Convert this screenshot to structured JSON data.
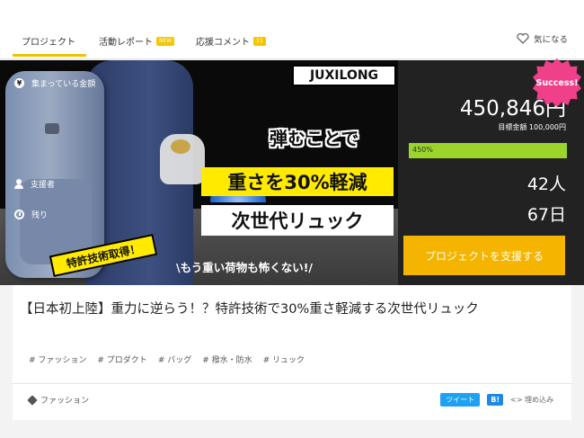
{
  "tabs": [
    {
      "label": "プロジェクト",
      "active": true
    },
    {
      "label": "活動レポート",
      "badge": "NEW"
    },
    {
      "label": "応援コメント",
      "badge": "11"
    }
  ],
  "favorite": {
    "label": "気になる",
    "icon": "heart-outline-icon"
  },
  "hero": {
    "brand": "JUXILONG",
    "line1": "弾むことで",
    "line2": "重さを30%軽減",
    "line3": "次世代リュック",
    "patent": "特許技術取得！",
    "tagline": "\\もう重い荷物も怖くない!/"
  },
  "funding": {
    "raised_label": "集まっている金額",
    "raised_amount": "450,846円",
    "goal": "目標金額 100,000円",
    "progress_text": "450%",
    "progress_fraction": 1.0,
    "supporters_label": "支援者",
    "supporters_value": "42人",
    "remaining_label": "残り",
    "remaining_value": "67日",
    "support_button": "プロジェクトを支援する",
    "success_badge": "Success!"
  },
  "project": {
    "title": "【日本初上陸】重力に逆らう！？特許技術で30%重さ軽減する次世代リュック",
    "tags": [
      "# ファッション",
      "# プロダクト",
      "# バッグ",
      "# 撥水・防水",
      "# リュック"
    ],
    "category": "ファッション",
    "share": {
      "tweet": "ツイート",
      "hatena": "B!",
      "embed": "埋め込み"
    }
  },
  "colors": {
    "accent": "#f5b400",
    "progress": "#9bd42a",
    "success": "#f0408a"
  }
}
